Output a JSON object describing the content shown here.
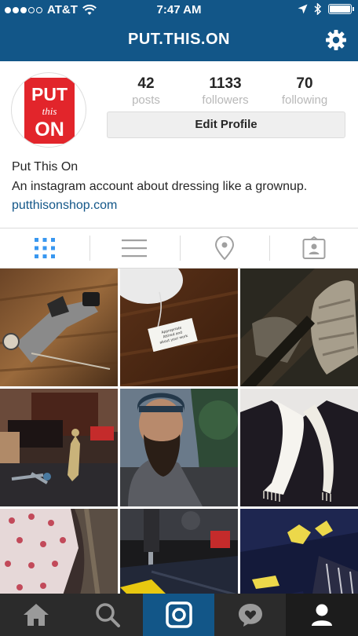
{
  "status_bar": {
    "carrier": "AT&T",
    "time": "7:47 AM"
  },
  "nav": {
    "title": "PUT.THIS.ON"
  },
  "profile": {
    "logo_text": [
      "PUT",
      "this",
      "ON"
    ],
    "stats": [
      {
        "num": "42",
        "label": "posts"
      },
      {
        "num": "1133",
        "label": "followers"
      },
      {
        "num": "70",
        "label": "following"
      }
    ],
    "edit_label": "Edit Profile",
    "name": "Put This On",
    "bio": "An instagram account about dressing like a grownup.",
    "link": "putthisonshop.com"
  },
  "tabs": [
    "grid-view-icon",
    "list-view-icon",
    "location-icon",
    "tagged-photos-icon"
  ],
  "grid": {
    "photos": [
      "vintage sewing tool on wooden table",
      "tag on wooden surface",
      "folded tweed garment",
      "desk with figurine and scissors",
      "bearded man in beanie",
      "white scarf on dark jacket",
      "pink patterned fabric",
      "sewing machine stitching fabric",
      "navy fabric with yellow shapes"
    ],
    "tag_text": [
      "Appropriate",
      "Attired and",
      "about your work"
    ]
  },
  "bottom_bar": [
    "home-icon",
    "search-icon",
    "camera-icon",
    "activity-icon",
    "profile-icon"
  ],
  "colors": {
    "brand": "#125688",
    "logo_red": "#e2252b",
    "bottom_bar": "#2b2b2b"
  }
}
